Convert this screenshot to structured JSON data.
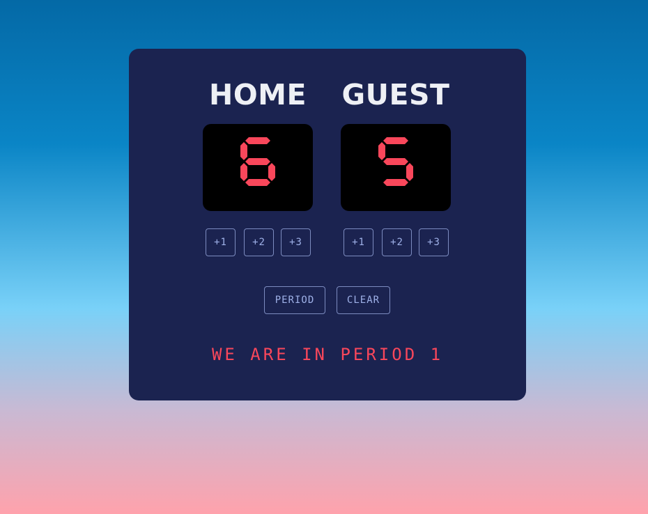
{
  "home": {
    "label": "HOME",
    "score": 6,
    "buttons": [
      "+1",
      "+2",
      "+3"
    ]
  },
  "guest": {
    "label": "GUEST",
    "score": 5,
    "buttons": [
      "+1",
      "+2",
      "+3"
    ]
  },
  "controls": {
    "period_label": "PERIOD",
    "clear_label": "CLEAR"
  },
  "status": {
    "message": "WE ARE IN PERIOD 1"
  },
  "colors": {
    "background_top": "#0469a6",
    "background_bottom": "#ffa2ac",
    "board": "#1b2350",
    "digit": "#f9475b",
    "button_text": "#9fb1e8"
  }
}
